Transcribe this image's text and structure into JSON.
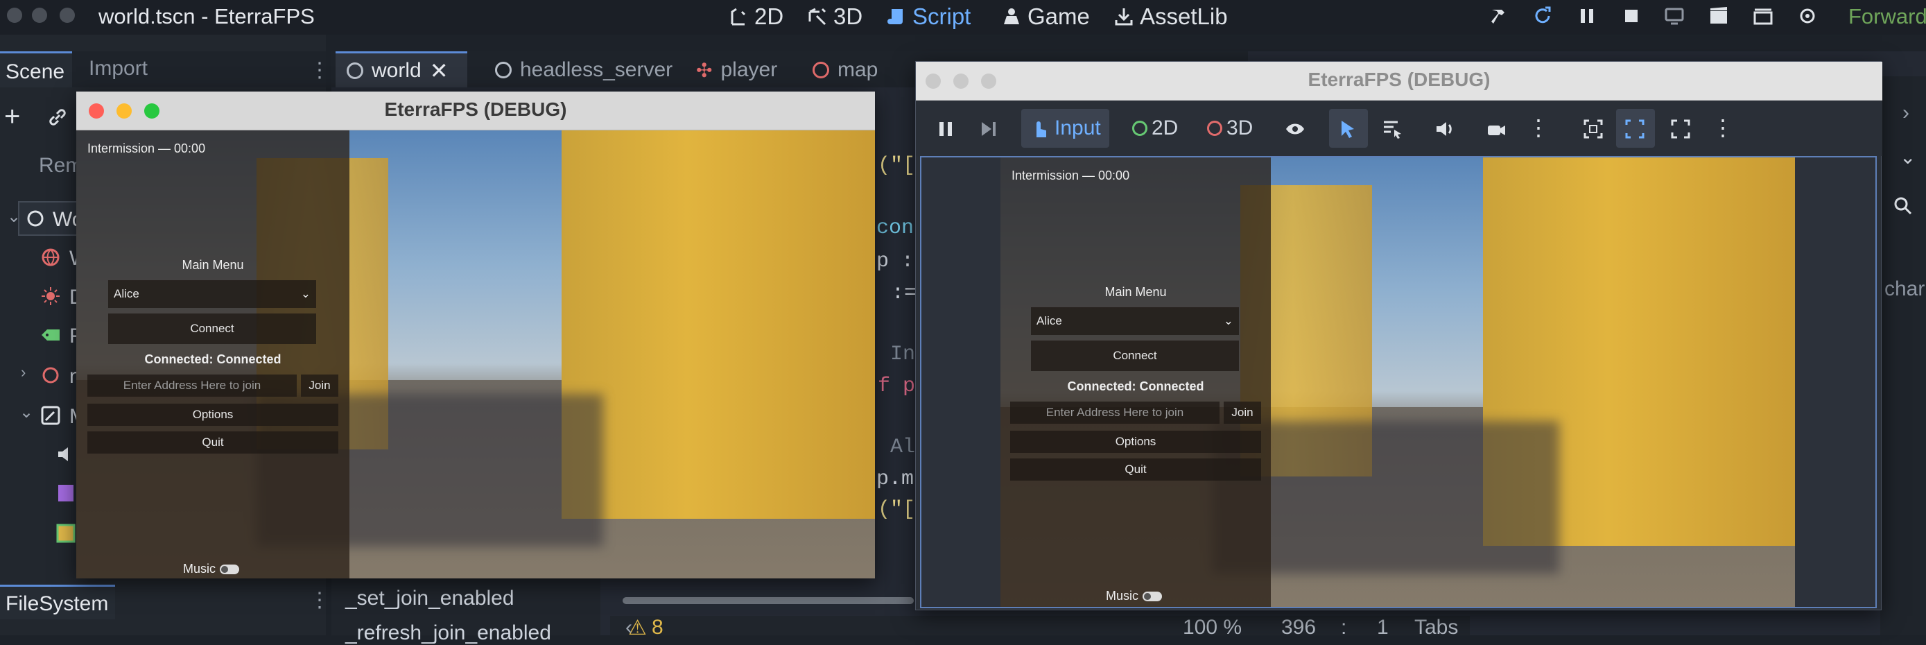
{
  "app": {
    "title": "world.tscn - EterraFPS",
    "renderer": "Forward"
  },
  "modes": [
    {
      "label": "2D",
      "icon": "2d-icon"
    },
    {
      "label": "3D",
      "icon": "3d-icon"
    },
    {
      "label": "Script",
      "icon": "script-icon"
    },
    {
      "label": "Game",
      "icon": "game-icon"
    },
    {
      "label": "AssetLib",
      "icon": "assetlib-icon"
    }
  ],
  "dock": {
    "tab_scene": "Scene",
    "tab_import": "Import",
    "rem_partial": "Rem",
    "root_partial": "Wo",
    "filesystem": "FileSystem",
    "tree_partials": [
      "W",
      "D",
      "F",
      "n",
      "M"
    ]
  },
  "editor": {
    "tabs": [
      "world",
      "headless_server",
      "player",
      "map"
    ],
    "code_fragments": [
      "(\"[",
      "con",
      "p :",
      ":=",
      "In",
      "f p",
      "Al",
      "p.m",
      "(\"["
    ],
    "methods": [
      "_set_join_enabled",
      "_refresh_join_enabled"
    ],
    "right_partial": "char",
    "status": {
      "warnings": "8",
      "zoom": "100 %",
      "line": "396",
      "col": "1",
      "indent": "Tabs"
    }
  },
  "debug_window": {
    "title": "EterraFPS (DEBUG)"
  },
  "game_toolbar": {
    "input": "Input",
    "d2": "2D",
    "d3": "3D"
  },
  "game_ui": {
    "intermission": "Intermission — 00:00",
    "main_menu": "Main Menu",
    "player_select": "Alice",
    "connect": "Connect",
    "connected_status": "Connected: Connected",
    "address_placeholder": "Enter Address Here to join",
    "join": "Join",
    "options": "Options",
    "quit": "Quit",
    "music": "Music"
  },
  "colors": {
    "accent": "#5c8bd6",
    "script_mode": "#6fb0ff",
    "renderer": "#6fa55a"
  }
}
